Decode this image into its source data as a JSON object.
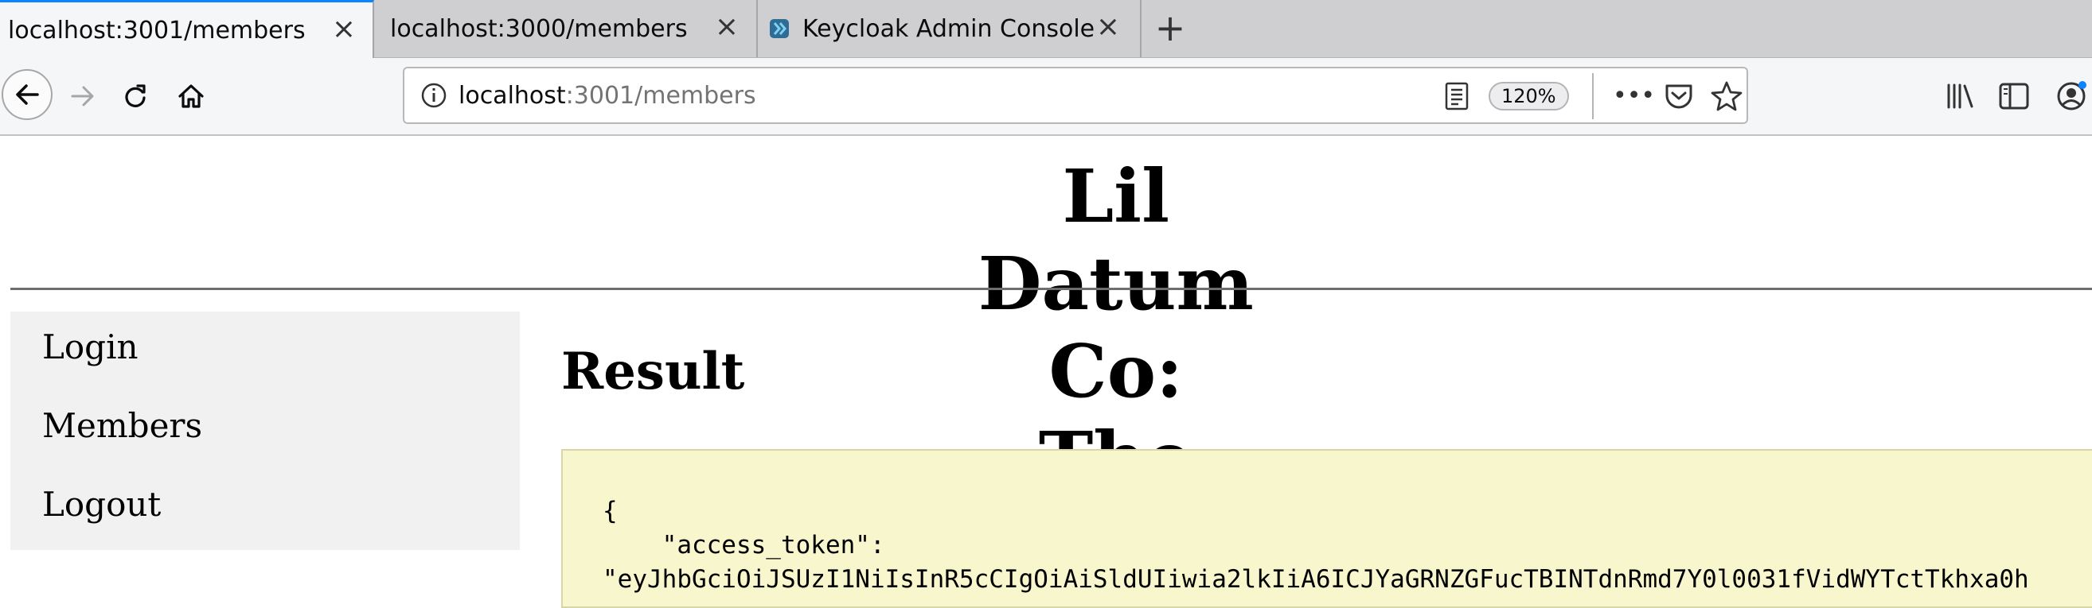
{
  "browser": {
    "tabs": [
      {
        "title": "localhost:3001/members",
        "active": true
      },
      {
        "title": "localhost:3000/members",
        "active": false
      },
      {
        "title": "Keycloak Admin Console",
        "active": false
      }
    ],
    "url": {
      "host": "localhost",
      "path": ":3001/members"
    },
    "zoom": "120%",
    "colors": {
      "active_tab_accent": "#0a84ff",
      "tabstrip": "#cfcfd1",
      "toolbar": "#f5f6f7"
    }
  },
  "page": {
    "title": "Lil Datum Co: The Second",
    "nav": [
      "Login",
      "Members",
      "Logout"
    ],
    "result_heading": "Result",
    "code_lines": [
      "{",
      "    \"access_token\":",
      "\"eyJhbGciOiJSUzI1NiIsInR5cCIgOiAiSldUIiwia2lkIiA6ICJYaGRNZGFucTBINTdnRmd7Y0l0031fVidWYTctTkhxa0h"
    ],
    "colors": {
      "code_background": "#f8f6cc",
      "sidebar_background": "#f1f1f1"
    }
  }
}
